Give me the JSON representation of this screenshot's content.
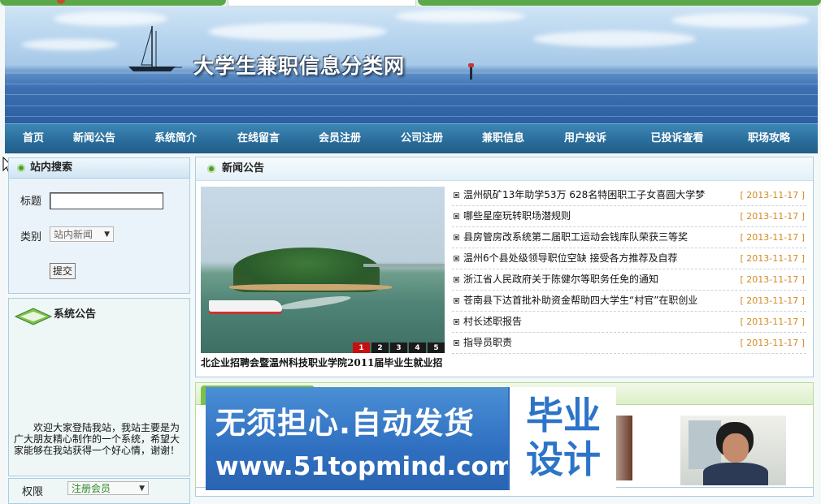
{
  "site": {
    "title": "大学生兼职信息分类网"
  },
  "nav": {
    "items": [
      "首页",
      "新闻公告",
      "系统简介",
      "在线留言",
      "会员注册",
      "公司注册",
      "兼职信息",
      "用户投诉",
      "已投诉查看",
      "职场攻略"
    ]
  },
  "search": {
    "heading": "站内搜索",
    "title_label": "标题",
    "title_value": "",
    "category_label": "类别",
    "category_value": "站内新闻",
    "submit_label": "提交"
  },
  "announcement": {
    "heading": "系统公告",
    "text": "欢迎大家登陆我站，我站主要是为广大朋友精心制作的一个系统，希望大家能够在我站获得一个好心情，谢谢！"
  },
  "permission": {
    "label": "权限",
    "value": "注册会员"
  },
  "news": {
    "heading": "新闻公告",
    "slide_caption": "北企业招聘会暨温州科技职业学院2011届毕业生就业招",
    "slide_pages": [
      "1",
      "2",
      "3",
      "4",
      "5"
    ],
    "items": [
      {
        "title": "温州矾矿13年助学53万 628名特困职工子女喜圆大学梦",
        "date": "[ 2013-11-17 ]"
      },
      {
        "title": "哪些星座玩转职场潜规则",
        "date": "[ 2013-11-17 ]"
      },
      {
        "title": "县房管房改系统第二届职工运动会钱库队荣获三等奖",
        "date": "[ 2013-11-17 ]"
      },
      {
        "title": "温州6个县处级领导职位空缺 接受各方推荐及自荐",
        "date": "[ 2013-11-17 ]"
      },
      {
        "title": "浙江省人民政府关于陈健尔等职务任免的通知",
        "date": "[ 2013-11-17 ]"
      },
      {
        "title": "苍南县下达首批补助资金帮助四大学生“村官”在职创业",
        "date": "[ 2013-11-17 ]"
      },
      {
        "title": "村长述职报告",
        "date": "[ 2013-11-17 ]"
      },
      {
        "title": "指导员职责",
        "date": "[ 2013-11-17 ]"
      }
    ]
  },
  "ad": {
    "line1": "无须担心.自动发货",
    "line2": "www.51topmind.com",
    "box": "毕业设计"
  }
}
